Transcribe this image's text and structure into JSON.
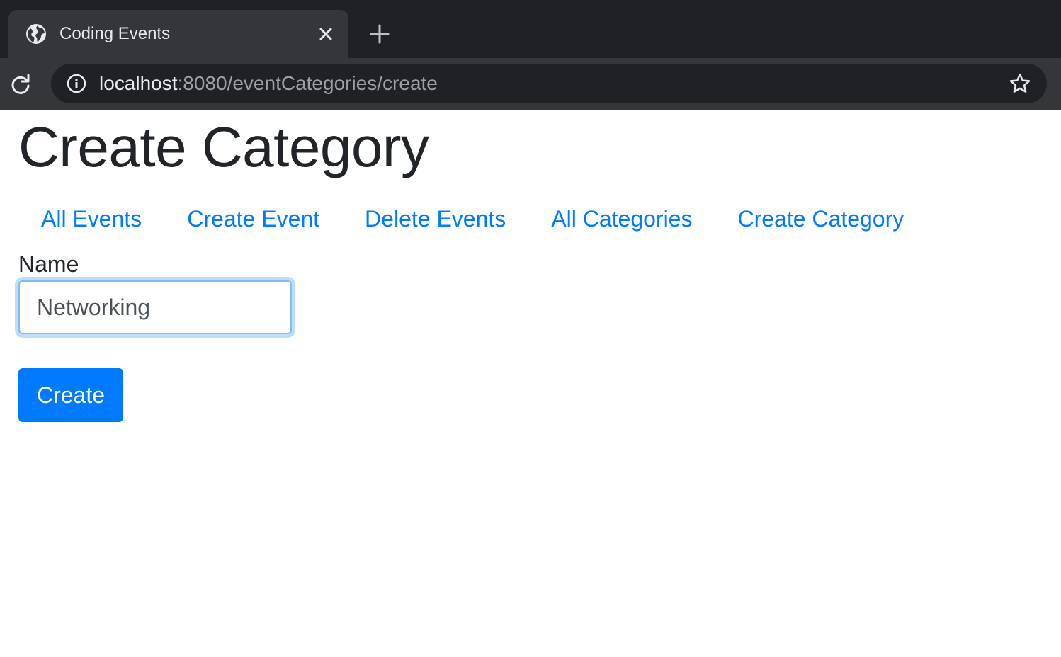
{
  "browser": {
    "tab": {
      "title": "Coding Events",
      "favicon": "globe-icon",
      "close_icon": "close-icon"
    },
    "new_tab_icon": "plus-icon",
    "reload_icon": "reload-icon",
    "info_icon": "info-icon",
    "bookmark_icon": "star-icon",
    "url": {
      "host": "localhost",
      "rest": ":8080/eventCategories/create"
    }
  },
  "page": {
    "title": "Create Category",
    "nav": [
      {
        "label": "All Events"
      },
      {
        "label": "Create Event"
      },
      {
        "label": "Delete Events"
      },
      {
        "label": "All Categories"
      },
      {
        "label": "Create Category"
      }
    ],
    "form": {
      "name_label": "Name",
      "name_value": "Networking",
      "submit_label": "Create"
    }
  },
  "colors": {
    "link": "#007bff",
    "button_bg": "#007bff",
    "heading": "#212529",
    "chrome_dark": "#202124",
    "chrome_tab": "#35363a",
    "focus_border": "#80bdff"
  }
}
